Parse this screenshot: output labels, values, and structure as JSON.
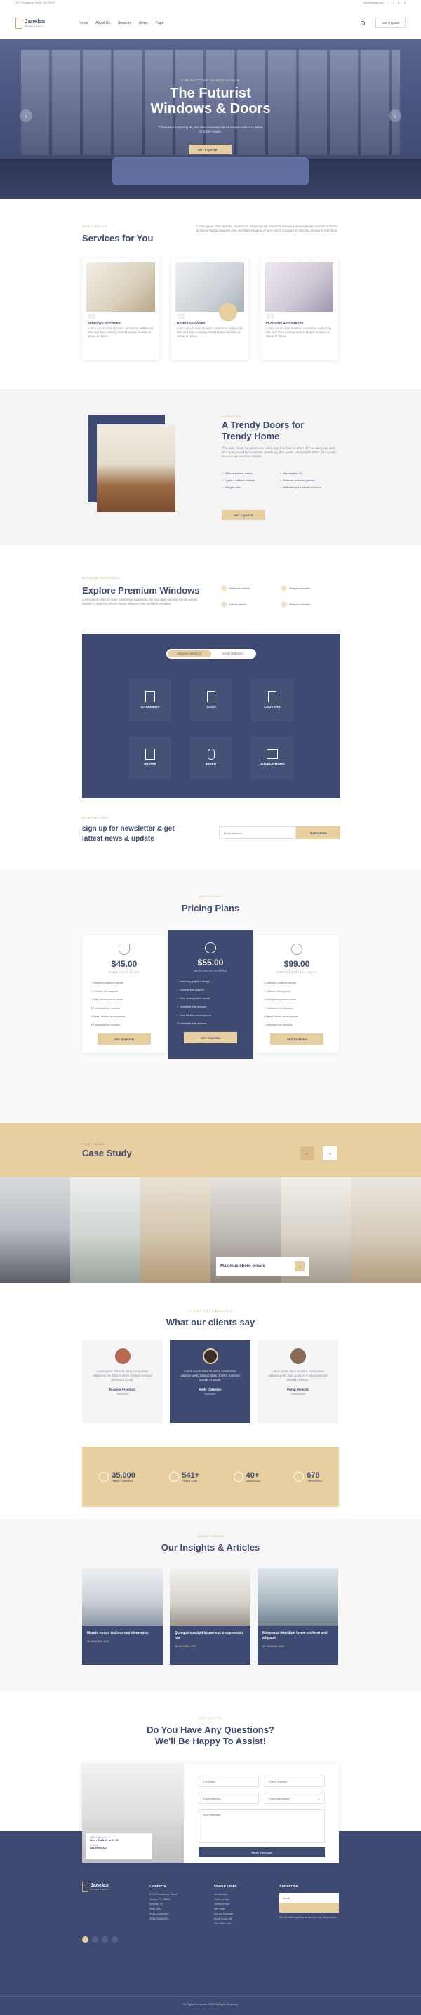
{
  "topbar": {
    "address": "4879 Providence Street, NH 03079",
    "email": "info@website.com",
    "socials": [
      "f",
      "t",
      "in",
      "p"
    ]
  },
  "header": {
    "logo_name": "Janelas",
    "logo_tag": "Windows & Doors",
    "nav": [
      "Home",
      "About Us",
      "Services",
      "News",
      "Page"
    ],
    "quote_btn": "Get A Quote"
  },
  "hero": {
    "eyebrow": "CONNECTING DISPOSSIBLE",
    "title_l1": "The Futurist",
    "title_l2": "Windows & Doors",
    "desc": "Consectetur adipiscing elit, sed diam nonummy eirmod tempor invidunt ut labore et dolore magna.",
    "btn": "GET A QUOTE"
  },
  "services": {
    "label": "WHAT WE DO",
    "title": "Services for You",
    "desc": "Lorem ipsum dolor sit amet, consectetur adipiscing elit, sed diam nonummy eirmod tempor invidunt ut labore et dolore magna aliquyam erat, sed diam voluptua. At vero eos et accusam et justo duo dolores et ea rebum.",
    "cards": [
      {
        "num": "01",
        "title": "WINDOWS SERVICES",
        "text": "Lorem ipsum dolor sit amet, consetetur sadipscing elitr, sed diam nonumy eirmod tempor invidunt ut labore et dolore"
      },
      {
        "num": "02",
        "title": "DOORS SERVICES",
        "text": "Lorem ipsum dolor sit amet, consetetur sadipscing elitr, sed diam nonumy eirmod tempor invidunt ut labore et dolore"
      },
      {
        "num": "03",
        "title": "PLANNING & PROJECTS",
        "text": "Lorem ipsum dolor sit amet, consetetur sadipscing elitr, sed diam nonumy eirmod tempor invidunt ut labore et dolore"
      }
    ]
  },
  "about": {
    "label": "ABOUT US",
    "title_l1": "A Trendy Doors for",
    "title_l2": "Trendy Home",
    "desc": "The quick, brown fox jumps over a lazy dog. DJs flock by when MTV ax quiz prog. Junk MTV quiz graced by fox whelps. Bawds jog, flick quartz, vex nymphs. Waltz, bad nymph, for quick jigs vex! Fox nymphs.",
    "features": [
      "Without Interior metus",
      "Nec dapibus id",
      "Ligula a ultrices tristique",
      "Pretemis posuere gravida",
      "Fringilla odio",
      "Pellentesque molestie rhoncus"
    ],
    "btn": "GET A QUOTE"
  },
  "premium": {
    "label": "WINDOW SERVICES",
    "title": "Explore Premium Windows",
    "desc": "Lorem ipsum dolor sit amet, consetetur sadipscing elitr, sed diam nonumy eirmod tempor invidunt ut labore et dolore magna aliquyam erat, sed diam voluptua.",
    "checks": [
      "Petersults ultrices",
      "Tempor commodo",
      "Dictum massa",
      "Tempor commodo"
    ],
    "tabs": [
      "WINDOW SERVICES",
      "DOOR SERVICES"
    ],
    "types": [
      "CASEMENT",
      "SASH",
      "LOUVERS",
      "PIVOTS",
      "FIXED",
      "DOUBLE-HUNG"
    ]
  },
  "newsletter": {
    "label": "NEWSLETTER",
    "title_l1": "sign up for newsletter & get",
    "title_l2": "lattest news & update",
    "placeholder": "Email Address",
    "btn": "SUBSCRIBE"
  },
  "pricing": {
    "label": "OUR PLANS",
    "title": "Pricing Plans",
    "plans": [
      {
        "price": "$45.00",
        "name": "SMALL BUSINESS",
        "btn": "GET STARTED"
      },
      {
        "price": "$55.00",
        "name": "MEDIUM BUSINESS",
        "btn": "GET STARTED"
      },
      {
        "price": "$99.00",
        "name": "CORPORATE BUSINESS",
        "btn": "GET STARTED"
      }
    ],
    "features": [
      "Branding graphics design",
      "Lifetime free support",
      "Web development course",
      "Unlimited free revision",
      "Best Lifetime development",
      "Unlimited free revision"
    ]
  },
  "case": {
    "label": "PORTFOLIO",
    "title": "Case Study",
    "caption": "Maximus libero ornare"
  },
  "testimonials": {
    "label": "CLIENT TESTIMONIALS",
    "title": "What our clients say",
    "items": [
      {
        "text": "Lorem ipsum dolor sit amet, consectetur adipiscing elit. Duis at ullam ut tellus euismod gravida et ipsum.",
        "name": "Eugene Freeman",
        "role": "Developer"
      },
      {
        "text": "Lorem ipsum dolor sit amet, consectetur adipiscing elit. Duis at ullam ut tellus euismod gravida et ipsum.",
        "name": "Kelly Coleman",
        "role": "Reformer"
      },
      {
        "text": "Lorem ipsum dolor sit amet, consectetur adipiscing elit. Duis at ullam ut tellus euismod gravida et ipsum.",
        "name": "Philip Mendez",
        "role": "Conveyancer"
      }
    ]
  },
  "stats": [
    {
      "num": "35,000",
      "label": "Happy Customers"
    },
    {
      "num": "541+",
      "label": "Project Done"
    },
    {
      "num": "40+",
      "label": "Awards Win"
    },
    {
      "num": "678",
      "label": "Client Works"
    }
  ],
  "blog": {
    "label": "LATEST NEWS",
    "title": "Our Insights & Articles",
    "posts": [
      {
        "title": "Mauris neque iculisur nec elementus",
        "date": "05 JANUARY, 2020"
      },
      {
        "title": "Quisque suscipit ipsum est, eu venenatis leo",
        "date": "05 JANUARY, 2020"
      },
      {
        "title": "Maecenas interdum lorem eleifend orci aliquam",
        "date": "05 JANUARY, 2020"
      }
    ]
  },
  "contact": {
    "label": "GET QUOTE",
    "title_l1": "Do You Have Any Questions?",
    "title_l2": "We'll Be Happy To Assist!",
    "hours_label": "Working Hours",
    "hours": "Mon - Sat 8.00 to 17.00",
    "call_label": "Call Us",
    "phone": "888-999-0000",
    "fields": [
      "Full Name",
      "Phone Number",
      "Email Address",
      "Choose services",
      "Your Message"
    ],
    "btn": "Send message"
  },
  "footer": {
    "logo_name": "Janelas",
    "logo_tag": "Windows & Doors",
    "contacts_h": "Contacts",
    "contacts": [
      "5719 Providence Street",
      "Tampa, FL 33620",
      "Sunrise, FL",
      "New York",
      "9991234567890",
      "9991234567890"
    ],
    "links_h": "Useful Links",
    "links": [
      "WorkWorks",
      "Terms of Use",
      "Terms of Use",
      "Site Map",
      "Get an Estimate",
      "Book Quick Lift",
      "The Team List"
    ],
    "sub_h": "Subscribe",
    "sub_placeholder": "Email",
    "sub_text": "Get the latest updates on service, buy our products.",
    "copyright": "All Rights Reserved. 2020 All Rights Reserved"
  }
}
